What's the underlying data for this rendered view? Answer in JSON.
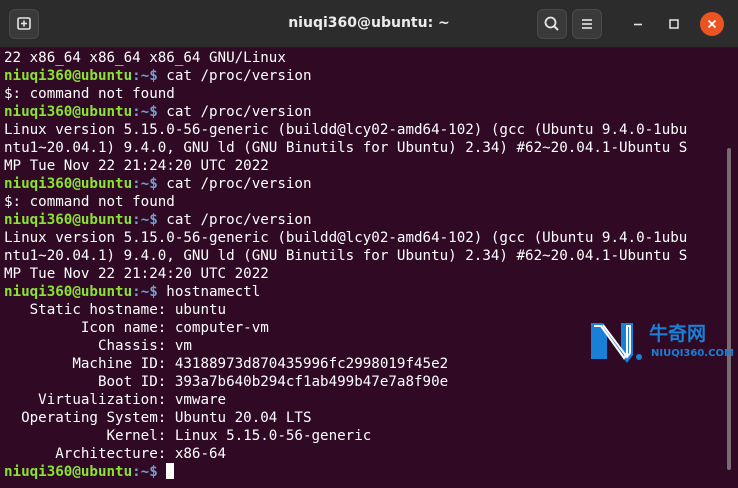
{
  "window": {
    "title": "niuqi360@ubuntu: ~"
  },
  "prompt": {
    "user_host": "niuqi360@ubuntu",
    "path_symbol": ":~$ "
  },
  "terminal_lines": [
    {
      "text": "22 x86_64 x86_64 x86_64 GNU/Linux"
    },
    {
      "prompt": true,
      "cmd": "cat /proc/version"
    },
    {
      "text": "$: command not found"
    },
    {
      "prompt": true,
      "cmd": "cat /proc/version"
    },
    {
      "text": "Linux version 5.15.0-56-generic (buildd@lcy02-amd64-102) (gcc (Ubuntu 9.4.0-1ubu"
    },
    {
      "text": "ntu1~20.04.1) 9.4.0, GNU ld (GNU Binutils for Ubuntu) 2.34) #62~20.04.1-Ubuntu S"
    },
    {
      "text": "MP Tue Nov 22 21:24:20 UTC 2022"
    },
    {
      "prompt": true,
      "cmd": "cat /proc/version"
    },
    {
      "text": "$: command not found"
    },
    {
      "prompt": true,
      "cmd": "cat /proc/version"
    },
    {
      "text": "Linux version 5.15.0-56-generic (buildd@lcy02-amd64-102) (gcc (Ubuntu 9.4.0-1ubu"
    },
    {
      "text": "ntu1~20.04.1) 9.4.0, GNU ld (GNU Binutils for Ubuntu) 2.34) #62~20.04.1-Ubuntu S"
    },
    {
      "text": "MP Tue Nov 22 21:24:20 UTC 2022"
    },
    {
      "prompt": true,
      "cmd": "hostnamectl"
    },
    {
      "text": "   Static hostname: ubuntu"
    },
    {
      "text": "         Icon name: computer-vm"
    },
    {
      "text": "           Chassis: vm"
    },
    {
      "text": "        Machine ID: 43188973d870435996fc2998019f45e2"
    },
    {
      "text": "           Boot ID: 393a7b640b294cf1ab499b47e7a8f90e"
    },
    {
      "text": "    Virtualization: vmware"
    },
    {
      "text": "  Operating System: Ubuntu 20.04 LTS"
    },
    {
      "text": "            Kernel: Linux 5.15.0-56-generic"
    },
    {
      "text": "      Architecture: x86-64"
    },
    {
      "prompt": true,
      "cmd": "",
      "cursor": true
    }
  ],
  "watermark": {
    "cn": "牛奇网",
    "en": "NIUQI360.COM"
  },
  "colors": {
    "background": "#300a24",
    "prompt_user": "#8ae234",
    "prompt_path": "#729fcf",
    "text": "#ffffff",
    "close_button": "#e95420",
    "watermark": "#1a7fd6"
  },
  "icons": {
    "new_tab": "new-tab-icon",
    "search": "search-icon",
    "menu": "hamburger-menu-icon",
    "minimize": "minimize-icon",
    "maximize": "maximize-icon",
    "close": "close-icon"
  }
}
